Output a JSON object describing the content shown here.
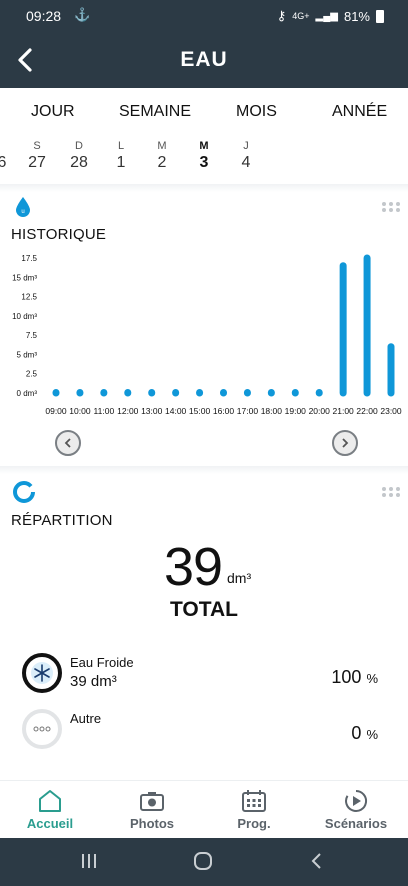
{
  "status_bar": {
    "time": "09:28",
    "notification_icon": "usb-icon",
    "network": "4G+",
    "battery": "81%"
  },
  "header": {
    "title": "EAU",
    "back_icon": "back-chevron-icon"
  },
  "periods": [
    "JOUR",
    "SEMAINE",
    "MOIS",
    "ANNÉE"
  ],
  "days": [
    {
      "letter": "",
      "num": "6"
    },
    {
      "letter": "S",
      "num": "27"
    },
    {
      "letter": "D",
      "num": "28"
    },
    {
      "letter": "L",
      "num": "1"
    },
    {
      "letter": "M",
      "num": "2"
    },
    {
      "letter": "M",
      "num": "3",
      "active": true
    },
    {
      "letter": "J",
      "num": "4"
    }
  ],
  "historique": {
    "title": "HISTORIQUE",
    "icon": "water-drop-icon"
  },
  "chart_data": {
    "type": "bar",
    "categories": [
      "09:00",
      "10:00",
      "11:00",
      "12:00",
      "13:00",
      "14:00",
      "15:00",
      "16:00",
      "17:00",
      "18:00",
      "19:00",
      "20:00",
      "21:00",
      "22:00",
      "23:00"
    ],
    "values": [
      0,
      0,
      0,
      0,
      0,
      0,
      0,
      0,
      0,
      0,
      0,
      0,
      16.5,
      17.5,
      6
    ],
    "y_ticks": [
      "0 dm³",
      "2.5",
      "5 dm³",
      "7.5",
      "10 dm³",
      "12.5",
      "15 dm³",
      "17.5"
    ],
    "y_tick_values": [
      0,
      2.5,
      5,
      7.5,
      10,
      12.5,
      15,
      17.5
    ],
    "ylim": [
      0,
      17.5
    ],
    "color": "#0f97d8",
    "grid": false
  },
  "repartition": {
    "title": "RÉPARTITION",
    "icon": "donut-chart-icon",
    "total_value": "39",
    "total_unit": "dm³",
    "total_label": "TOTAL",
    "items": [
      {
        "name": "Eau Froide",
        "volume": "39 dm³",
        "percent": "100",
        "percent_unit": "%",
        "icon": "snowflake-icon"
      },
      {
        "name": "Autre",
        "volume": "",
        "percent": "0",
        "percent_unit": "%",
        "icon": "more-dots-icon"
      }
    ]
  },
  "bottom_nav": [
    {
      "label": "Accueil",
      "icon": "home-icon",
      "active": true
    },
    {
      "label": "Photos",
      "icon": "camera-icon"
    },
    {
      "label": "Prog.",
      "icon": "calendar-icon"
    },
    {
      "label": "Scénarios",
      "icon": "play-circle-icon"
    }
  ],
  "colors": {
    "header_bg": "#2c3a45",
    "accent_blue": "#0f97d8",
    "active_tab": "#2a9d8f"
  }
}
